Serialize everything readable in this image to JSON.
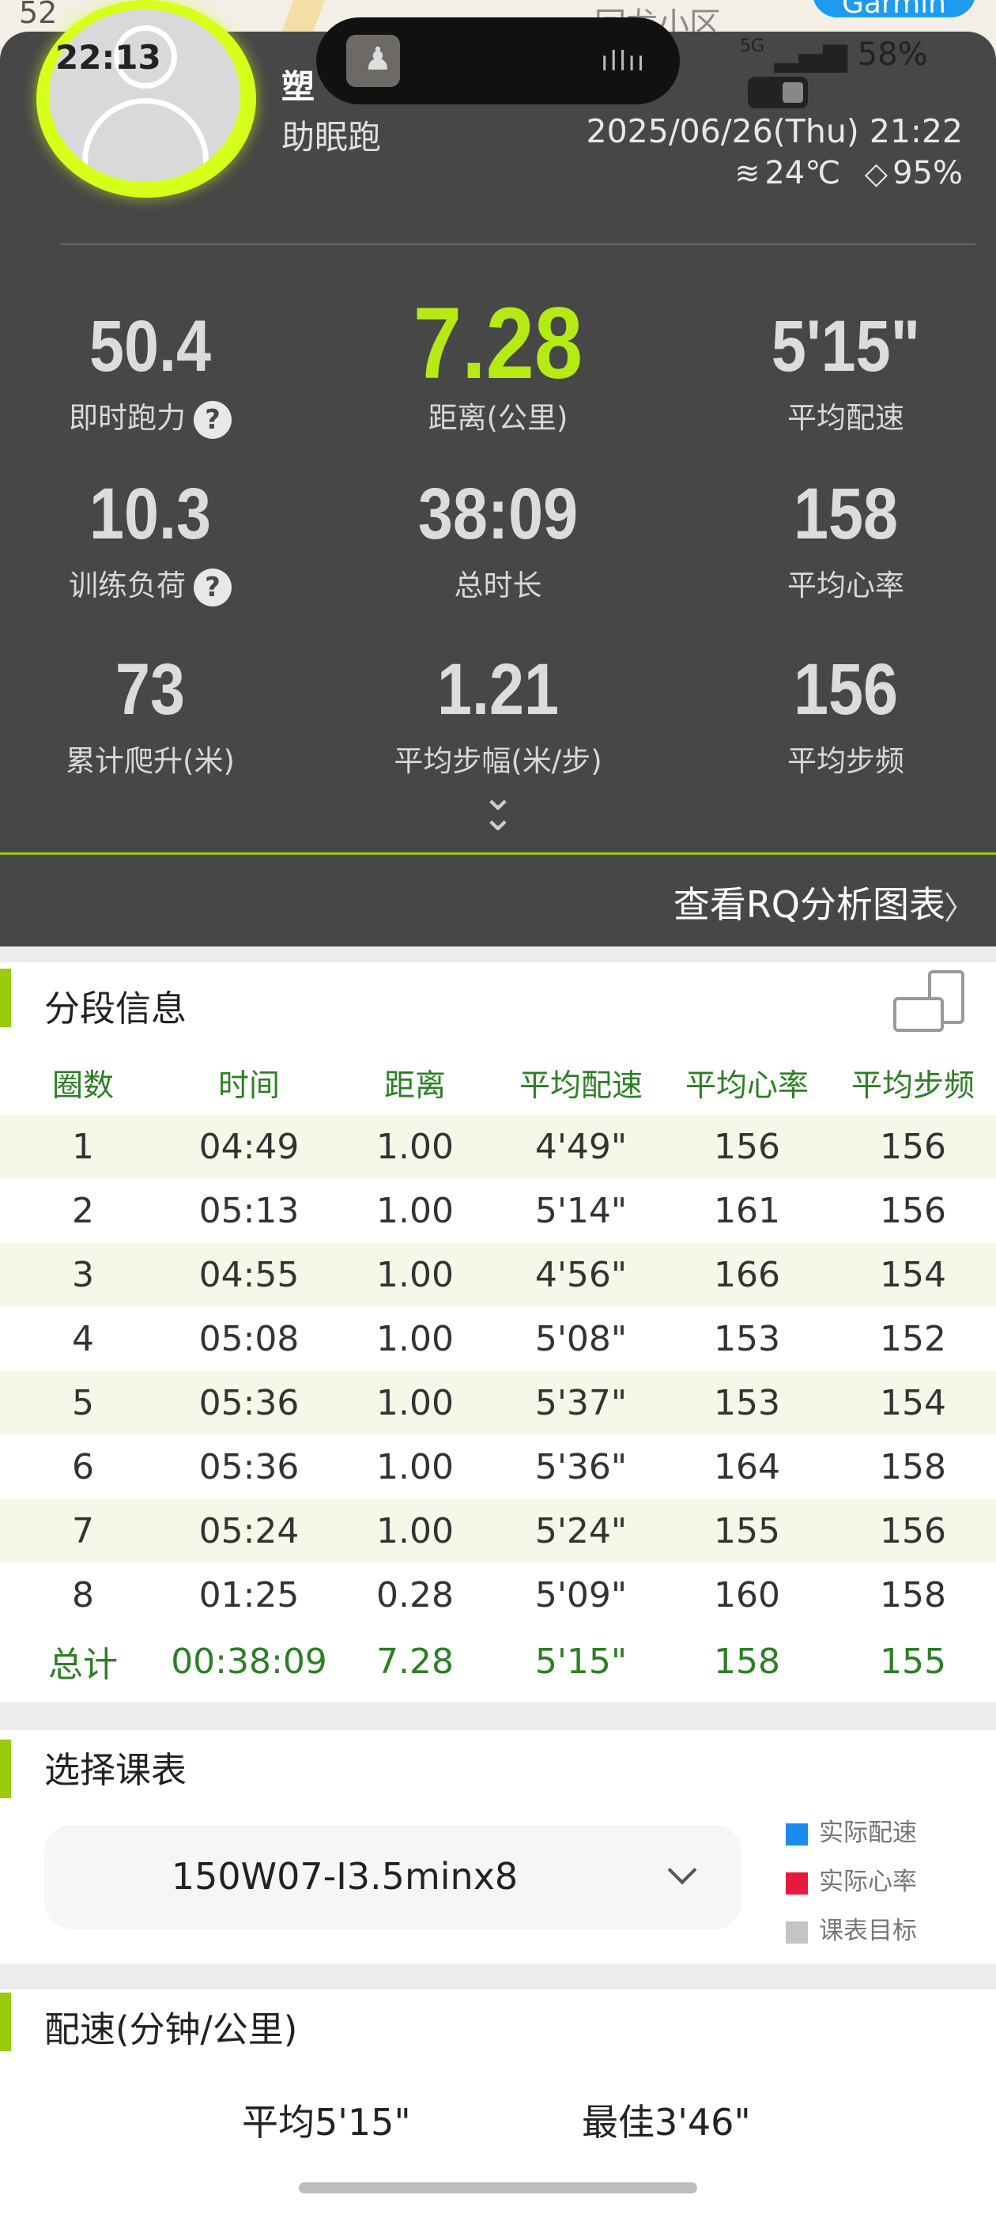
{
  "map": {
    "place_fragment": "回龙小区",
    "left_fragment": "52",
    "brand": "Garmin"
  },
  "status_bar": {
    "time": "22:13",
    "network": "5G",
    "battery": "58%"
  },
  "header": {
    "user_name": "塑",
    "activity": "助眠跑",
    "datetime": "2025/06/26(Thu) 21:22",
    "wind": "24℃",
    "humidity": "95%"
  },
  "stats": [
    {
      "value": "50.4",
      "label": "即时跑力",
      "help": "?"
    },
    {
      "value": "7.28",
      "label": "距离(公里)"
    },
    {
      "value": "5'15\"",
      "label": "平均配速"
    },
    {
      "value": "10.3",
      "label": "训练负荷",
      "help": "?"
    },
    {
      "value": "38:09",
      "label": "总时长"
    },
    {
      "value": "158",
      "label": "平均心率"
    },
    {
      "value": "73",
      "label": "累计爬升(米)"
    },
    {
      "value": "1.21",
      "label": "平均步幅(米/步)"
    },
    {
      "value": "156",
      "label": "平均步频"
    }
  ],
  "rq_link": "查看RQ分析图表",
  "splits": {
    "title": "分段信息",
    "columns": [
      "圈数",
      "时间",
      "距离",
      "平均配速",
      "平均心率",
      "平均步频"
    ],
    "rows": [
      [
        "1",
        "04:49",
        "1.00",
        "4'49\"",
        "156",
        "156"
      ],
      [
        "2",
        "05:13",
        "1.00",
        "5'14\"",
        "161",
        "156"
      ],
      [
        "3",
        "04:55",
        "1.00",
        "4'56\"",
        "166",
        "154"
      ],
      [
        "4",
        "05:08",
        "1.00",
        "5'08\"",
        "153",
        "152"
      ],
      [
        "5",
        "05:36",
        "1.00",
        "5'37\"",
        "153",
        "154"
      ],
      [
        "6",
        "05:36",
        "1.00",
        "5'36\"",
        "164",
        "158"
      ],
      [
        "7",
        "05:24",
        "1.00",
        "5'24\"",
        "155",
        "156"
      ],
      [
        "8",
        "01:25",
        "0.28",
        "5'09\"",
        "160",
        "158"
      ]
    ],
    "total": [
      "总计",
      "00:38:09",
      "7.28",
      "5'15\"",
      "158",
      "155"
    ]
  },
  "plan": {
    "title": "选择课表",
    "selected": "150W07-I3.5minx8",
    "legend": [
      {
        "label": "实际配速",
        "color": "#1a8cf0"
      },
      {
        "label": "实际心率",
        "color": "#e8193c"
      },
      {
        "label": "课表目标",
        "color": "#c4c4c4"
      }
    ]
  },
  "pace": {
    "title": "配速(分钟/公里)",
    "average": "平均5'15\"",
    "best": "最佳3'46\""
  },
  "colors": {
    "accent_green": "#9acb0c",
    "highlight_value": "#b5ea14",
    "table_green": "#2d7f25",
    "card_bg": "#474747"
  }
}
